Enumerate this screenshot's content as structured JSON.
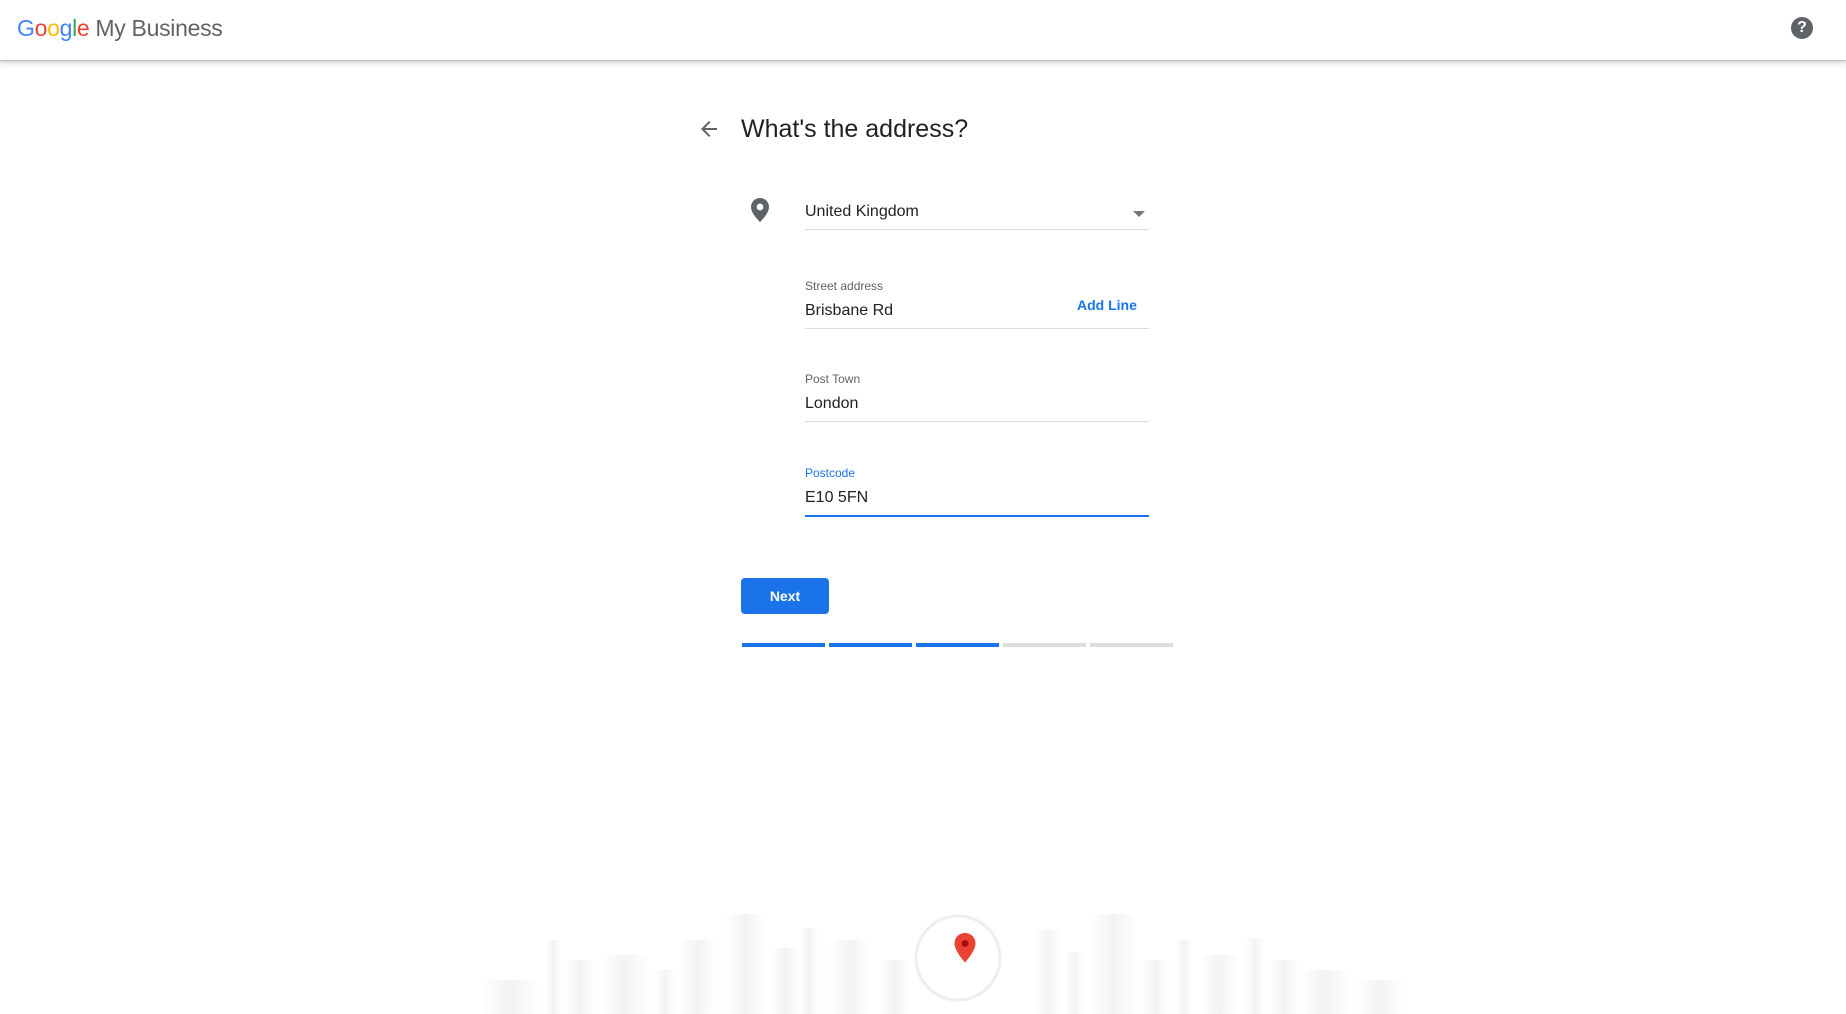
{
  "header": {
    "logo_google": [
      "G",
      "o",
      "o",
      "g",
      "l",
      "e"
    ],
    "logo_colors": [
      "#4285F4",
      "#EA4335",
      "#FBBC05",
      "#4285F4",
      "#34A853",
      "#EA4335"
    ],
    "logo_product": "My Business",
    "help_symbol": "?"
  },
  "form": {
    "title": "What's the address?",
    "country": {
      "value": "United Kingdom",
      "icon": "location-pin-icon"
    },
    "street": {
      "label": "Street address",
      "value": "Brisbane Rd",
      "add_line": "Add Line"
    },
    "town": {
      "label": "Post Town",
      "value": "London"
    },
    "postcode": {
      "label": "Postcode",
      "value": "E10 5FN"
    },
    "next_label": "Next",
    "progress": {
      "completed_steps": 3,
      "total_steps": 5
    }
  },
  "colors": {
    "accent": "#1a73e8",
    "pin_red": "#EA4335",
    "muted": "#5f6368"
  }
}
